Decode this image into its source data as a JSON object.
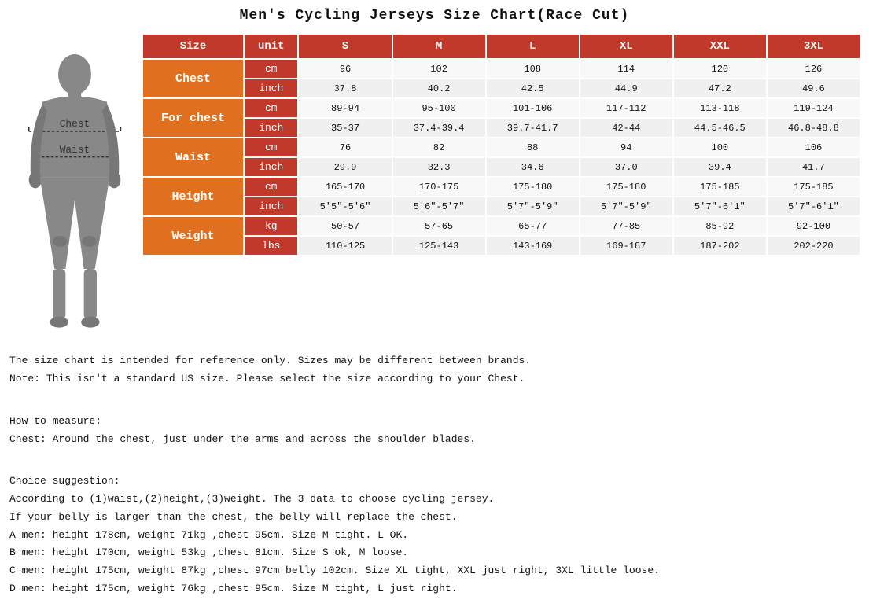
{
  "title": "Men's Cycling Jerseys Size Chart(Race Cut)",
  "table": {
    "header": {
      "col_size": "Size",
      "col_unit": "unit",
      "col_s": "S",
      "col_m": "M",
      "col_l": "L",
      "col_xl": "XL",
      "col_xxl": "XXL",
      "col_3xl": "3XL"
    },
    "rows": [
      {
        "category": "Chest",
        "rowspan": 2,
        "sub": [
          {
            "unit": "cm",
            "s": "96",
            "m": "102",
            "l": "108",
            "xl": "114",
            "xxl": "120",
            "3xl": "126"
          },
          {
            "unit": "inch",
            "s": "37.8",
            "m": "40.2",
            "l": "42.5",
            "xl": "44.9",
            "xxl": "47.2",
            "3xl": "49.6"
          }
        ]
      },
      {
        "category": "For chest",
        "rowspan": 2,
        "sub": [
          {
            "unit": "cm",
            "s": "89-94",
            "m": "95-100",
            "l": "101-106",
            "xl": "117-112",
            "xxl": "113-118",
            "3xl": "119-124"
          },
          {
            "unit": "inch",
            "s": "35-37",
            "m": "37.4-39.4",
            "l": "39.7-41.7",
            "xl": "42-44",
            "xxl": "44.5-46.5",
            "3xl": "46.8-48.8"
          }
        ]
      },
      {
        "category": "Waist",
        "rowspan": 2,
        "sub": [
          {
            "unit": "cm",
            "s": "76",
            "m": "82",
            "l": "88",
            "xl": "94",
            "xxl": "100",
            "3xl": "106"
          },
          {
            "unit": "inch",
            "s": "29.9",
            "m": "32.3",
            "l": "34.6",
            "xl": "37.0",
            "xxl": "39.4",
            "3xl": "41.7"
          }
        ]
      },
      {
        "category": "Height",
        "rowspan": 2,
        "sub": [
          {
            "unit": "cm",
            "s": "165-170",
            "m": "170-175",
            "l": "175-180",
            "xl": "175-180",
            "xxl": "175-185",
            "3xl": "175-185"
          },
          {
            "unit": "inch",
            "s": "5'5\"-5'6\"",
            "m": "5'6\"-5'7\"",
            "l": "5'7\"-5'9\"",
            "xl": "5'7\"-5'9\"",
            "xxl": "5'7\"-6'1\"",
            "3xl": "5'7\"-6'1\""
          }
        ]
      },
      {
        "category": "Weight",
        "rowspan": 2,
        "sub": [
          {
            "unit": "kg",
            "s": "50-57",
            "m": "57-65",
            "l": "65-77",
            "xl": "77-85",
            "xxl": "85-92",
            "3xl": "92-100"
          },
          {
            "unit": "lbs",
            "s": "110-125",
            "m": "125-143",
            "l": "143-169",
            "xl": "169-187",
            "xxl": "187-202",
            "3xl": "202-220"
          }
        ]
      }
    ]
  },
  "notes": {
    "line1": "The size chart is intended for reference only. Sizes may be different between brands.",
    "line2": "Note: This isn't a standard US size. Please select the size according to your Chest.",
    "blank1": "",
    "line3": "How to measure:",
    "line4": "  Chest: Around the chest, just under the arms and across the shoulder blades.",
    "blank2": "",
    "line5": "Choice suggestion:",
    "line6": "According to (1)waist,(2)height,(3)weight. The 3 data to choose cycling jersey.",
    "line7": "If your belly is larger than the chest, the belly will replace the chest.",
    "line8": "A men: height 178cm, weight 71kg ,chest 95cm. Size M tight. L OK.",
    "line9": "B men: height 170cm, weight 53kg ,chest 81cm. Size S ok, M loose.",
    "line10": "C men: height 175cm, weight 87kg ,chest 97cm belly 102cm. Size XL tight, XXL just right, 3XL little loose.",
    "line11": "D men: height 175cm, weight 76kg ,chest 95cm. Size M tight, L just right."
  }
}
